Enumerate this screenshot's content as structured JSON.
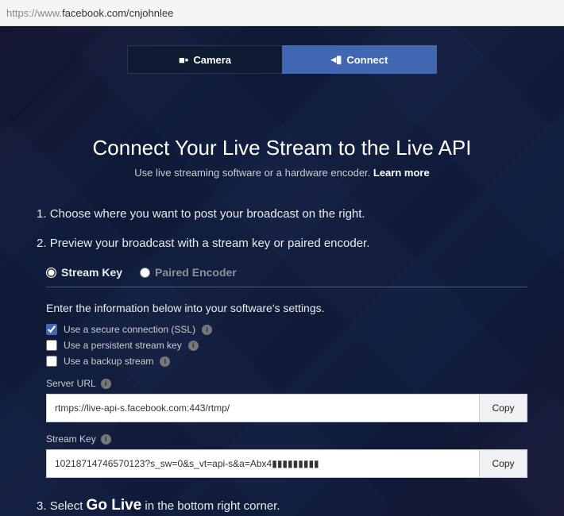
{
  "url": {
    "protocol": "https://",
    "host_prefix": "www.",
    "rest": "facebook.com/cnjohnlee"
  },
  "tabs": {
    "camera": "Camera",
    "connect": "Connect"
  },
  "heading": "Connect Your Live Stream to the Live API",
  "subheading_a": "Use live streaming software or a hardware encoder. ",
  "subheading_b": "Learn more",
  "step1": "Choose where you want to post your broadcast on the right.",
  "step2": "Preview your broadcast with a stream key or paired encoder.",
  "radios": {
    "key": "Stream Key",
    "paired": "Paired Encoder"
  },
  "instruction": "Enter the information below into your software's settings.",
  "checks": {
    "ssl": "Use a secure connection (SSL)",
    "persist": "Use a persistent stream key",
    "backup": "Use a backup stream"
  },
  "serverUrl": {
    "label": "Server URL",
    "value": "rtmps://live-api-s.facebook.com:443/rtmp/"
  },
  "streamKey": {
    "label": "Stream Key",
    "value": "10218714746570123?s_sw=0&s_vt=api-s&a=Abx4▮▮▮▮▮▮▮▮▮"
  },
  "copy": "Copy",
  "step3_a": "Select ",
  "step3_b": "Go Live",
  "step3_c": " in the bottom right corner.",
  "n1": "1. ",
  "n2": "2. ",
  "n3": "3. "
}
